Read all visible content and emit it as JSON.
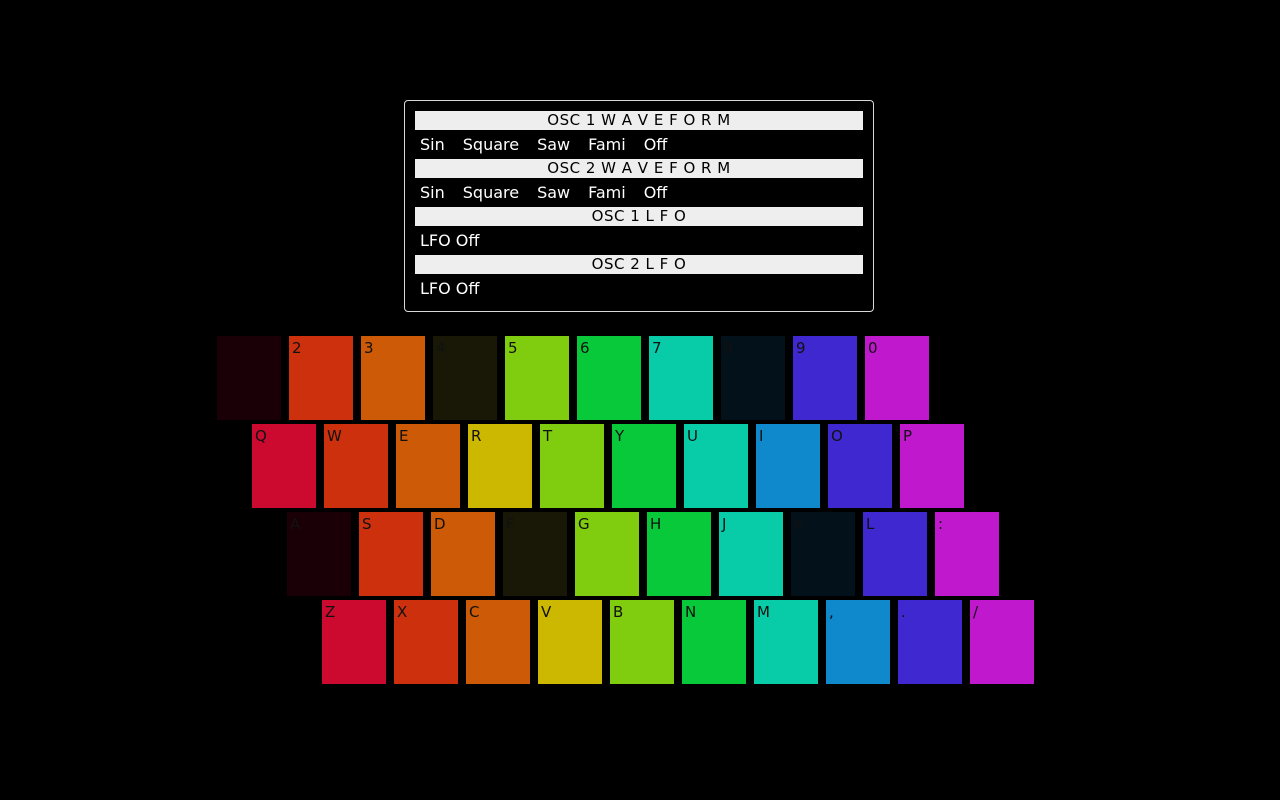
{
  "panel": {
    "sections": [
      {
        "header": "OSC 1 W A V E F O R M",
        "options": [
          "Sin",
          "Square",
          "Saw",
          "Fami",
          "Off"
        ]
      },
      {
        "header": "OSC 2 W A V E F O R M",
        "options": [
          "Sin",
          "Square",
          "Saw",
          "Fami",
          "Off"
        ]
      },
      {
        "header": "OSC 1 L F O",
        "options": [
          "LFO Off"
        ]
      },
      {
        "header": "OSC 2 L F O",
        "options": [
          "LFO Off"
        ]
      }
    ]
  },
  "keyboard": {
    "rows": [
      {
        "keys": [
          {
            "label": "",
            "color": "#1a0006"
          },
          {
            "label": "2",
            "color": "#cc300c"
          },
          {
            "label": "3",
            "color": "#cc5a06"
          },
          {
            "label": "4",
            "color": "#191806"
          },
          {
            "label": "5",
            "color": "#80cc0e"
          },
          {
            "label": "6",
            "color": "#08c93a"
          },
          {
            "label": "7",
            "color": "#08cca8"
          },
          {
            "label": "8",
            "color": "#03111a"
          },
          {
            "label": "9",
            "color": "#4028d0"
          },
          {
            "label": "0",
            "color": "#c018cc"
          }
        ]
      },
      {
        "keys": [
          {
            "label": "Q",
            "color": "#cc0a30"
          },
          {
            "label": "W",
            "color": "#cc300c"
          },
          {
            "label": "E",
            "color": "#cc5a06"
          },
          {
            "label": "R",
            "color": "#ccb800"
          },
          {
            "label": "T",
            "color": "#80cc0e"
          },
          {
            "label": "Y",
            "color": "#08c93a"
          },
          {
            "label": "U",
            "color": "#08cca8"
          },
          {
            "label": "I",
            "color": "#0f88cc"
          },
          {
            "label": "O",
            "color": "#4028d0"
          },
          {
            "label": "P",
            "color": "#c018cc"
          }
        ]
      },
      {
        "keys": [
          {
            "label": "A",
            "color": "#1a0006"
          },
          {
            "label": "S",
            "color": "#cc300c"
          },
          {
            "label": "D",
            "color": "#cc5a06"
          },
          {
            "label": "F",
            "color": "#191806"
          },
          {
            "label": "G",
            "color": "#80cc0e"
          },
          {
            "label": "H",
            "color": "#08c93a"
          },
          {
            "label": "J",
            "color": "#08cca8"
          },
          {
            "label": "K",
            "color": "#03111a"
          },
          {
            "label": "L",
            "color": "#4028d0"
          },
          {
            "label": ":",
            "color": "#c018cc"
          }
        ]
      },
      {
        "keys": [
          {
            "label": "Z",
            "color": "#cc0a30"
          },
          {
            "label": "X",
            "color": "#cc300c"
          },
          {
            "label": "C",
            "color": "#cc5a06"
          },
          {
            "label": "V",
            "color": "#ccb800"
          },
          {
            "label": "B",
            "color": "#80cc0e"
          },
          {
            "label": "N",
            "color": "#08c93a"
          },
          {
            "label": "M",
            "color": "#08cca8"
          },
          {
            "label": ",",
            "color": "#0f88cc"
          },
          {
            "label": ".",
            "color": "#4028d0"
          },
          {
            "label": "/",
            "color": "#c018cc"
          }
        ]
      }
    ]
  }
}
